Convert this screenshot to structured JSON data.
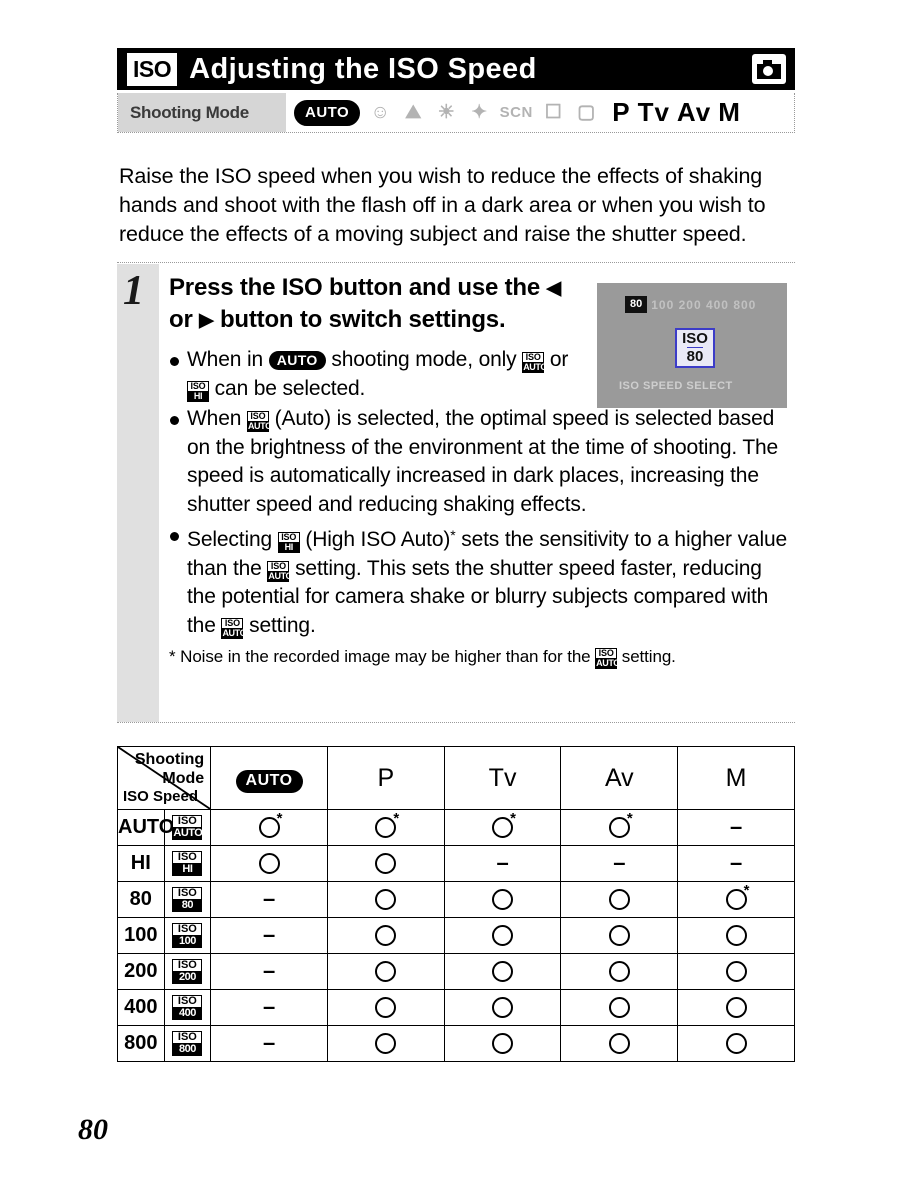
{
  "header": {
    "iso_badge": "ISO",
    "title": "Adjusting the ISO Speed",
    "camera_icon": "camera-icon"
  },
  "mode_strip": {
    "label": "Shooting Mode",
    "auto_label": "AUTO",
    "scene_icons": [
      "portrait-icon",
      "landscape-icon",
      "night-scene-icon",
      "kids-pets-icon",
      "SCN",
      "indoor-icon",
      "movie-icon"
    ],
    "manual_modes": [
      "P",
      "Tv",
      "Av",
      "M"
    ]
  },
  "intro": "Raise the ISO speed when you wish to reduce the effects of shaking hands and shoot with the flash off in a dark area or when you wish to reduce the effects of a moving subject and raise the shutter speed.",
  "step": {
    "number": "1",
    "heading_part1": "Press the ISO button and use the ",
    "heading_left_arrow": "◀",
    "heading_or": " or ",
    "heading_right_arrow": "▶",
    "heading_part2": " button to switch settings.",
    "bullet1": {
      "a": "When in ",
      "auto": "AUTO",
      "b": " shooting mode, only ",
      "icon1_top": "ISO",
      "icon1_bottom": "AUTO",
      "c": " or ",
      "icon2_top": "ISO",
      "icon2_bottom": "HI",
      "d": " can be selected."
    },
    "bullet2": {
      "a": "When ",
      "icon_top": "ISO",
      "icon_bottom": "AUTO",
      "b": " (Auto) is selected, the optimal speed is selected based on the brightness of the environment at the time of shooting. The speed is automatically increased in dark places, increasing the shutter speed and reducing shaking effects."
    },
    "bullet3": {
      "a": "Selecting ",
      "icon1_top": "ISO",
      "icon1_bottom": "HI",
      "b": " (High ISO Auto)",
      "star": "*",
      "c": " sets the sensitivity to a higher value than the ",
      "icon2_top": "ISO",
      "icon2_bottom": "AUTO",
      "d": " setting. This sets the shutter speed faster, reducing the potential for camera shake or blurry subjects compared with the ",
      "icon3_top": "ISO",
      "icon3_bottom": "AUTO",
      "e": " setting."
    },
    "footnote": {
      "a": "* Noise in the recorded image may be higher than for the ",
      "icon_top": "ISO",
      "icon_bottom": "AUTO",
      "b": " setting."
    }
  },
  "lcd": {
    "chip": "80",
    "top_ghost": "100 200 400 800",
    "center_top": "ISO",
    "center_bottom": "80",
    "bottom_ghost": "ISO SPEED SELECT"
  },
  "table": {
    "corner_row_header": "Shooting Mode",
    "corner_col_header": "ISO Speed",
    "columns": [
      "AUTO",
      "P",
      "Tv",
      "Av",
      "M"
    ],
    "rows": [
      {
        "label": "AUTO",
        "icon_top": "ISO",
        "icon_bottom": "AUTO",
        "values": [
          "O*",
          "O*",
          "O*",
          "O*",
          "-"
        ]
      },
      {
        "label": "HI",
        "icon_top": "ISO",
        "icon_bottom": "HI",
        "values": [
          "O",
          "O",
          "-",
          "-",
          "-"
        ]
      },
      {
        "label": "80",
        "icon_top": "ISO",
        "icon_bottom": "80",
        "values": [
          "-",
          "O",
          "O",
          "O",
          "O*"
        ]
      },
      {
        "label": "100",
        "icon_top": "ISO",
        "icon_bottom": "100",
        "values": [
          "-",
          "O",
          "O",
          "O",
          "O"
        ]
      },
      {
        "label": "200",
        "icon_top": "ISO",
        "icon_bottom": "200",
        "values": [
          "-",
          "O",
          "O",
          "O",
          "O"
        ]
      },
      {
        "label": "400",
        "icon_top": "ISO",
        "icon_bottom": "400",
        "values": [
          "-",
          "O",
          "O",
          "O",
          "O"
        ]
      },
      {
        "label": "800",
        "icon_top": "ISO",
        "icon_bottom": "800",
        "values": [
          "-",
          "O",
          "O",
          "O",
          "O"
        ]
      }
    ]
  },
  "page_number": "80"
}
